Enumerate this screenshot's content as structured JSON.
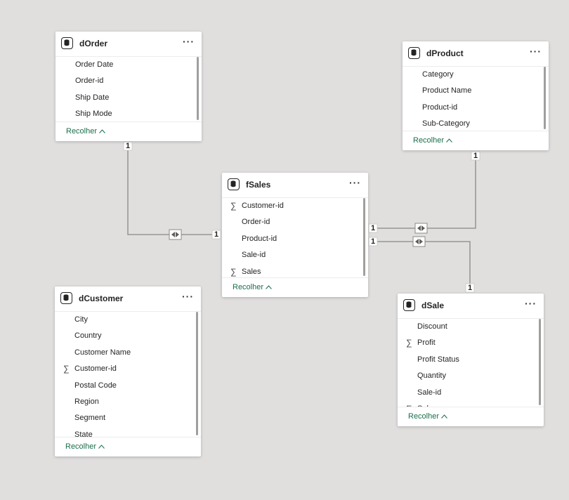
{
  "collapse_label": "Recolher",
  "cardinality_one": "1",
  "tables": {
    "dOrder": {
      "name": "dOrder",
      "more": "···",
      "fields": [
        {
          "name": "Order Date",
          "sigma": ""
        },
        {
          "name": "Order-id",
          "sigma": ""
        },
        {
          "name": "Ship Date",
          "sigma": ""
        },
        {
          "name": "Ship Mode",
          "sigma": ""
        }
      ]
    },
    "dProduct": {
      "name": "dProduct",
      "more": "···",
      "fields": [
        {
          "name": "Category",
          "sigma": ""
        },
        {
          "name": "Product Name",
          "sigma": ""
        },
        {
          "name": "Product-id",
          "sigma": ""
        },
        {
          "name": "Sub-Category",
          "sigma": ""
        }
      ]
    },
    "fSales": {
      "name": "fSales",
      "more": "···",
      "fields": [
        {
          "name": "Customer-id",
          "sigma": "∑"
        },
        {
          "name": "Order-id",
          "sigma": ""
        },
        {
          "name": "Product-id",
          "sigma": ""
        },
        {
          "name": "Sale-id",
          "sigma": ""
        },
        {
          "name": "Sales",
          "sigma": "∑"
        }
      ]
    },
    "dCustomer": {
      "name": "dCustomer",
      "more": "···",
      "fields": [
        {
          "name": "City",
          "sigma": ""
        },
        {
          "name": "Country",
          "sigma": ""
        },
        {
          "name": "Customer Name",
          "sigma": ""
        },
        {
          "name": "Customer-id",
          "sigma": "∑"
        },
        {
          "name": "Postal Code",
          "sigma": ""
        },
        {
          "name": "Region",
          "sigma": ""
        },
        {
          "name": "Segment",
          "sigma": ""
        },
        {
          "name": "State",
          "sigma": ""
        }
      ]
    },
    "dSale": {
      "name": "dSale",
      "more": "···",
      "fields": [
        {
          "name": "Discount",
          "sigma": ""
        },
        {
          "name": "Profit",
          "sigma": "∑"
        },
        {
          "name": "Profit Status",
          "sigma": ""
        },
        {
          "name": "Quantity",
          "sigma": ""
        },
        {
          "name": "Sale-id",
          "sigma": ""
        },
        {
          "name": "Sales",
          "sigma": "∑"
        }
      ]
    }
  },
  "relationships": [
    {
      "from": "dOrder",
      "to": "fSales",
      "cardinality": "1:1",
      "direction": "both"
    },
    {
      "from": "dProduct",
      "to": "fSales",
      "cardinality": "1:1",
      "direction": "both"
    },
    {
      "from": "dSale",
      "to": "fSales",
      "cardinality": "1:1",
      "direction": "both"
    }
  ]
}
